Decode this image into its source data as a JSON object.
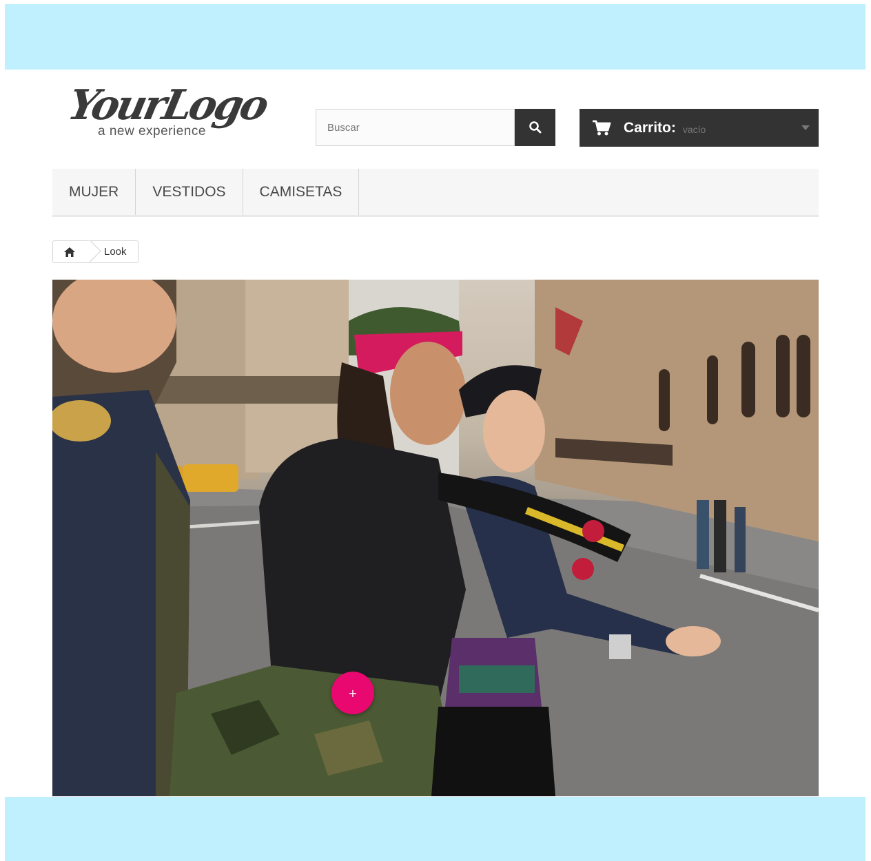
{
  "logo": {
    "script": "YourLogo",
    "tagline": "a new experience"
  },
  "search": {
    "placeholder": "Buscar",
    "icon": "search-icon"
  },
  "cart": {
    "label": "Carrito:",
    "status": "vacío",
    "icon": "cart-icon"
  },
  "menu": {
    "items": [
      {
        "label": "MUJER"
      },
      {
        "label": "VESTIDOS"
      },
      {
        "label": "CAMISETAS"
      }
    ]
  },
  "breadcrumb": {
    "home_icon": "home-icon",
    "current": "Look"
  },
  "hero": {
    "hotspot_label": "+"
  },
  "colors": {
    "band": "#c0f0fd",
    "dark": "#333333",
    "accent": "#e8086f"
  }
}
